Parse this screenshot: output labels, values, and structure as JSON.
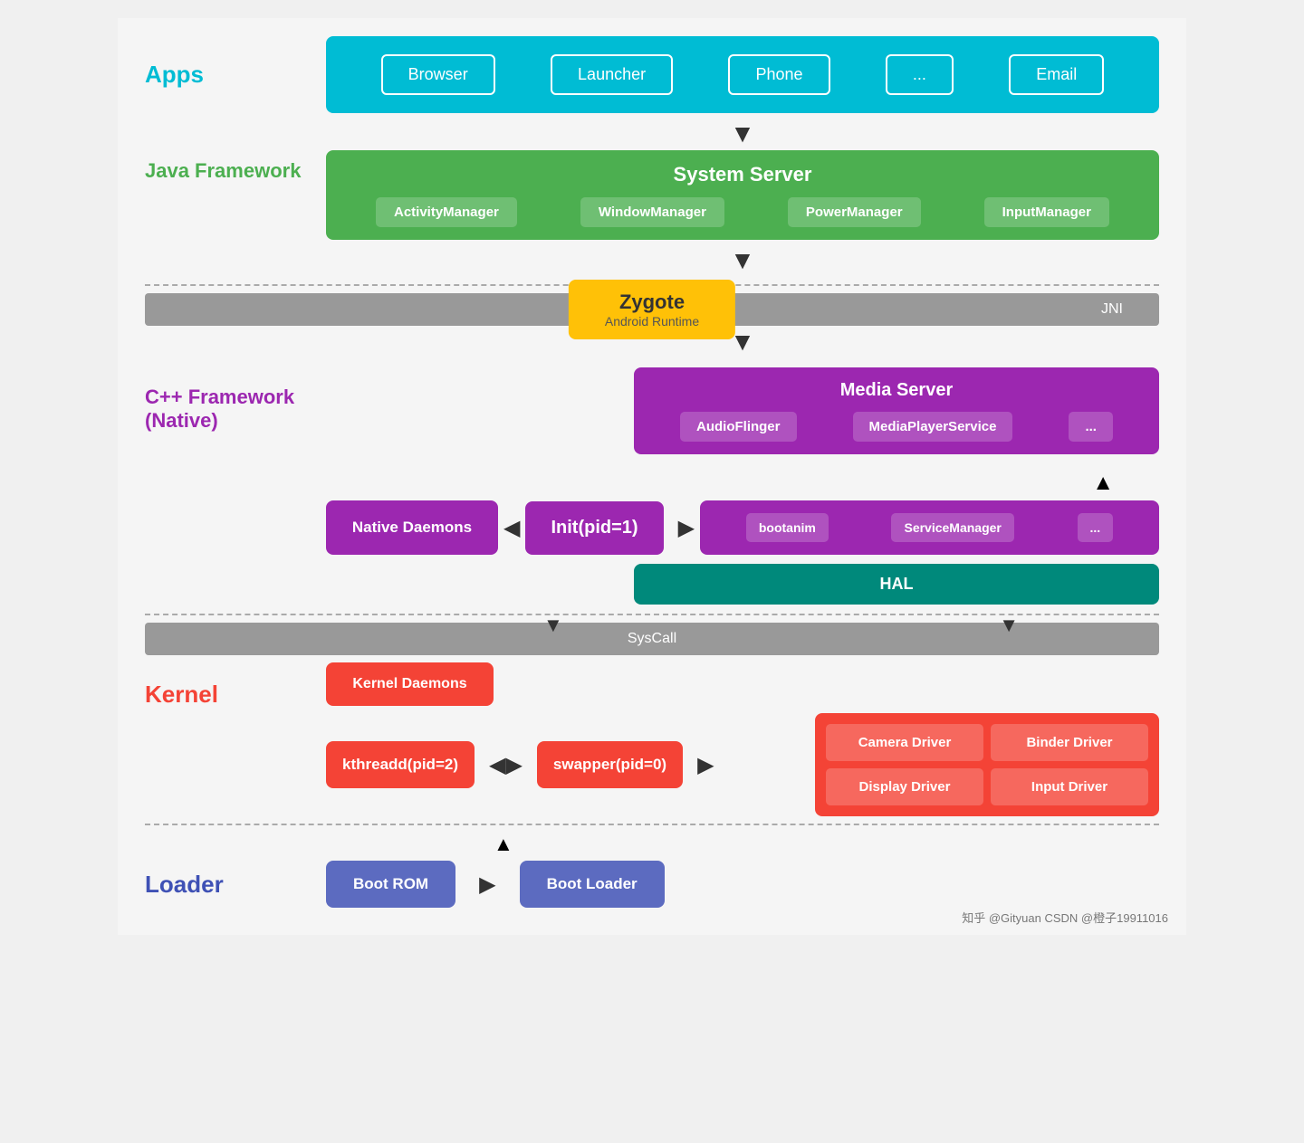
{
  "apps": {
    "label": "Apps",
    "items": [
      "Browser",
      "Launcher",
      "Phone",
      "...",
      "Email"
    ]
  },
  "java_framework": {
    "label": "Java Framework",
    "system_server": {
      "title": "System Server",
      "items": [
        "ActivityManager",
        "WindowManager",
        "PowerManager",
        "InputManager"
      ]
    }
  },
  "jni": {
    "label": "JNI"
  },
  "zygote": {
    "title": "Zygote",
    "sub": "Android Runtime"
  },
  "cpp_framework": {
    "label": "C++ Framework\n(Native)",
    "line1": "C++ Framework",
    "line2": "(Native)",
    "media_server": {
      "title": "Media Server",
      "items": [
        "AudioFlinger",
        "MediaPlayerService",
        "..."
      ]
    },
    "native_daemons": "Native Daemons",
    "init": "Init(pid=1)",
    "services": {
      "items": [
        "bootanim",
        "ServiceManager",
        "..."
      ]
    },
    "hal": "HAL"
  },
  "syscall": {
    "label": "SysCall"
  },
  "kernel": {
    "label": "Kernel",
    "kernel_daemons": "Kernel Daemons",
    "kthreadd": "kthreadd(pid=2)",
    "swapper": "swapper(pid=0)",
    "drivers": [
      "Camera Driver",
      "Binder Driver",
      "Display Driver",
      "Input Driver"
    ]
  },
  "loader": {
    "label": "Loader",
    "boot_rom": "Boot ROM",
    "boot_loader": "Boot Loader"
  },
  "watermark": "知乎 @Gityuan\nCSDN @橙子19911016"
}
